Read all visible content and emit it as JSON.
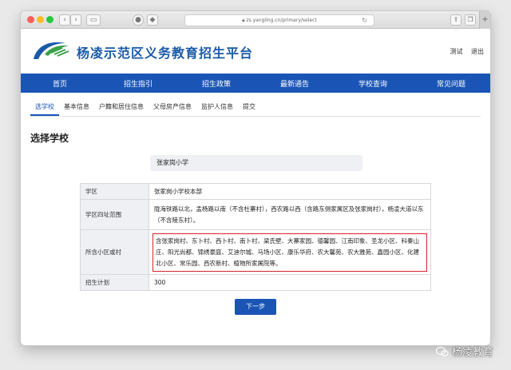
{
  "browser": {
    "url": "zs.yangling.cn/primary/select",
    "back": "‹",
    "forward": "›"
  },
  "header": {
    "title": "杨凌示范区义务教育招生平台",
    "links": [
      "测试",
      "退出"
    ]
  },
  "nav": [
    "首页",
    "招生指引",
    "招生政策",
    "最新通告",
    "学校查询",
    "常见问题"
  ],
  "steps": [
    "选学校",
    "基本信息",
    "户籍和居住信息",
    "父母房产信息",
    "监护人信息",
    "提交"
  ],
  "page": {
    "title": "选择学校",
    "selected_school": "张家岗小学",
    "rows": [
      {
        "label": "学区",
        "value": "张家岗小学校本部"
      },
      {
        "label": "学区四址范围",
        "value": "陇海铁路以北，孟杨路以南（不含杜寨村），西农路以西（含路东侧家属区及张家岗村），杨凌大道以东（不含陵东村）。"
      },
      {
        "label": "所含小区或村",
        "value": "含张家岗村、东卜村、西卜村、南卜村、梁氏壁、大寨家园、德馨园、江南印象、圣龙小区、科秦山庄、阳光尚都、锦绣豪庭、艾迪尔城、马场小区、康乐华府、农大馨苑、农大雅苑、鑫园小区、化建北小区、常乐园、西农新村、植物所家属院等。"
      },
      {
        "label": "招生计划",
        "value": "300"
      }
    ],
    "next_label": "下一步"
  },
  "watermark": "杨凌教育"
}
